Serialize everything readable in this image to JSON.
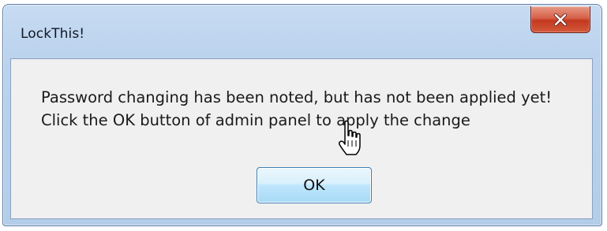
{
  "window": {
    "title": "LockThis!",
    "close_label": "X"
  },
  "dialog": {
    "message_lines": [
      "Password changing has been noted, but has not been applied yet!",
      "Click the OK button of admin panel to apply the change"
    ],
    "ok_label": "OK"
  },
  "icons": {
    "close": "close-icon",
    "cursor": "hand-pointer-cursor-icon"
  },
  "colors": {
    "frame": "#b7d0ea",
    "close_button": "#c7452c",
    "client_background": "#f0f0f0",
    "ok_button_focus": "#bee6fd"
  }
}
